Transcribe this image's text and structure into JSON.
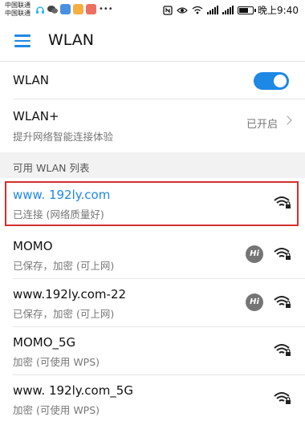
{
  "status_bar": {
    "carrier1": "中国联通",
    "carrier2": "中国联通",
    "time": "晚上9:40",
    "icons": [
      "nfc-icon",
      "eye-icon",
      "wifi-icon",
      "4g-icon",
      "signal-icon",
      "battery-icon"
    ]
  },
  "app_bar": {
    "title": "WLAN"
  },
  "wlan_toggle": {
    "label": "WLAN",
    "state": "on"
  },
  "wlan_plus": {
    "title": "WLAN+",
    "subtitle": "提升网络智能连接体验",
    "status": "已开启"
  },
  "section": {
    "label": "可用 WLAN 列表"
  },
  "networks": [
    {
      "name": "www. 192ly.com",
      "status": "已连接 (网络质量好)",
      "connected": true,
      "hi_badge": false,
      "locked": true
    },
    {
      "name": "MOMO",
      "status": "已保存，加密 (可上网)",
      "connected": false,
      "hi_badge": true,
      "hi_text": "Hi",
      "locked": true
    },
    {
      "name": "www.192ly.com-22",
      "status": "已保存，加密 (可上网)",
      "connected": false,
      "hi_badge": true,
      "hi_text": "Hi",
      "locked": true
    },
    {
      "name": "MOMO_5G",
      "status": "加密 (可使用 WPS)",
      "connected": false,
      "hi_badge": false,
      "locked": true
    },
    {
      "name": "www. 192ly.com_5G",
      "status": "加密 (可使用 WPS)",
      "connected": false,
      "hi_badge": false,
      "locked": true
    }
  ],
  "colors": {
    "accent": "#1e88e5",
    "highlight": "#d32f2f",
    "connected_text": "#1e88e5"
  }
}
